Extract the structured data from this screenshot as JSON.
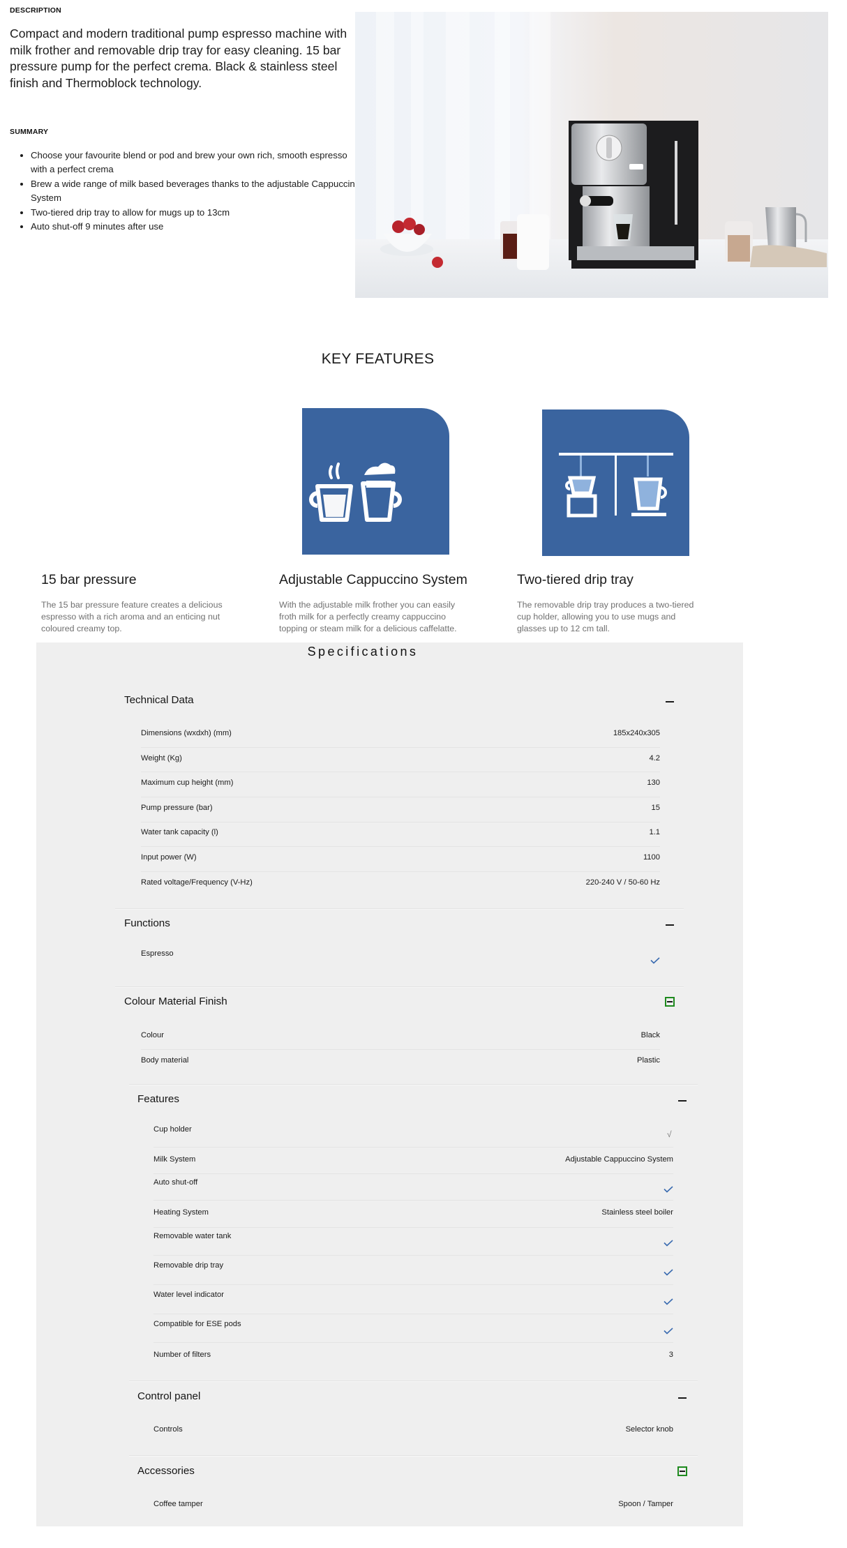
{
  "description": {
    "label": "DESCRIPTION",
    "text": "Compact and modern traditional pump espresso machine with milk frother and removable drip tray for easy cleaning. 15 bar pressure pump for the perfect crema. Black & stainless steel finish and Thermoblock technology."
  },
  "summary": {
    "label": "SUMMARY",
    "items": [
      "Choose your favourite blend or pod and brew your own rich, smooth espresso with a perfect crema",
      "Brew a wide range of milk based beverages thanks to the adjustable Cappuccino System",
      "Two-tiered drip tray to allow for mugs up to 13cm",
      "Auto shut-off 9 minutes after use"
    ]
  },
  "hero_image": {
    "alt": "Espresso machine on a kitchen counter with cups, strawberries and a milk jug"
  },
  "key_features": {
    "title": "KEY FEATURES",
    "accent_color": "#3a649f",
    "items": [
      {
        "icon": "none",
        "title": "15 bar pressure",
        "body": "The 15 bar pressure feature creates a delicious espresso with a rich aroma and an enticing nut coloured creamy top."
      },
      {
        "icon": "cappuccino-cups-icon",
        "title": "Adjustable Cappuccino System",
        "body": "With the adjustable milk frother you can easily froth milk for a perfectly creamy cappuccino topping or steam milk for a delicious caffelatte."
      },
      {
        "icon": "two-tiered-drip-tray-icon",
        "title": "Two-tiered drip tray",
        "body": "The removable drip tray produces a two-tiered cup holder, allowing you to use mugs and glasses up to 12 cm tall."
      }
    ]
  },
  "specifications": {
    "title": "Specifications",
    "check_color": "#3a6bb0",
    "focus_color": "#1e8a1e",
    "sections": [
      {
        "name": "Technical Data",
        "toggle": "collapse",
        "rows": [
          {
            "label": "Dimensions (wxdxh) (mm)",
            "value": "185x240x305"
          },
          {
            "label": "Weight (Kg)",
            "value": "4.2"
          },
          {
            "label": "Maximum cup height (mm)",
            "value": "130"
          },
          {
            "label": "Pump pressure (bar)",
            "value": "15"
          },
          {
            "label": "Water tank capacity (l)",
            "value": "1.1"
          },
          {
            "label": "Input power (W)",
            "value": "1100"
          },
          {
            "label": "Rated voltage/Frequency (V-Hz)",
            "value": "220-240 V / 50-60 Hz"
          }
        ]
      },
      {
        "name": "Functions",
        "toggle": "collapse",
        "rows": [
          {
            "label": "Espresso",
            "value": "check"
          }
        ]
      },
      {
        "name": "Colour Material Finish",
        "toggle": "collapse-focused",
        "rows": [
          {
            "label": "Colour",
            "value": "Black"
          },
          {
            "label": "Body material",
            "value": "Plastic"
          }
        ]
      },
      {
        "name": "Features",
        "toggle": "collapse",
        "rows": [
          {
            "label": "Cup holder",
            "value": "√"
          },
          {
            "label": "Milk System",
            "value": "Adjustable Cappuccino System"
          },
          {
            "label": "Auto shut-off",
            "value": "check"
          },
          {
            "label": "Heating System",
            "value": "Stainless steel boiler"
          },
          {
            "label": "Removable water tank",
            "value": "check"
          },
          {
            "label": "Removable drip tray",
            "value": "check"
          },
          {
            "label": "Water level indicator",
            "value": "check"
          },
          {
            "label": "Compatible for ESE pods",
            "value": "check"
          },
          {
            "label": "Number of filters",
            "value": "3"
          }
        ]
      },
      {
        "name": "Control panel",
        "toggle": "collapse",
        "rows": [
          {
            "label": "Controls",
            "value": "Selector knob"
          }
        ]
      },
      {
        "name": "Accessories",
        "toggle": "collapse-focused",
        "rows": [
          {
            "label": "Coffee tamper",
            "value": "Spoon / Tamper"
          }
        ]
      }
    ]
  }
}
